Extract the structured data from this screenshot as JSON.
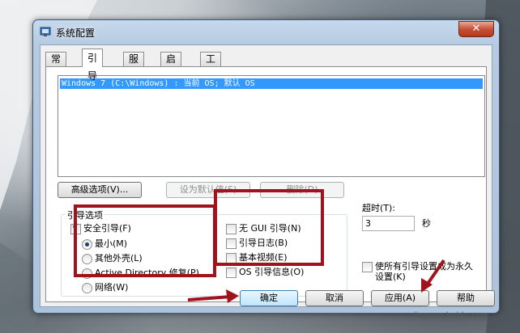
{
  "window": {
    "title": "系统配置",
    "close_label": "✕"
  },
  "tabs": [
    {
      "label": "常规"
    },
    {
      "label": "引导"
    },
    {
      "label": "服务"
    },
    {
      "label": "启动"
    },
    {
      "label": "工具"
    }
  ],
  "boot_list": {
    "items": [
      "Windows 7 (C:\\Windows) : 当前 OS; 默认 OS"
    ]
  },
  "entry_buttons": {
    "advanced": "高级选项(V)...",
    "set_default": "设为默认值(S)",
    "delete": "删除(D)"
  },
  "boot_options": {
    "group_title": "引导选项",
    "safe_boot": {
      "label": "安全引导(F)",
      "checked": true
    },
    "radios": [
      {
        "label": "最小(M)",
        "checked": true
      },
      {
        "label": "其他外壳(L)",
        "checked": false
      },
      {
        "label": "Active Directory 修复(P)",
        "checked": false
      },
      {
        "label": "网络(W)",
        "checked": false
      }
    ],
    "checkboxes": [
      {
        "label": "无 GUI 引导(N)",
        "checked": false
      },
      {
        "label": "引导日志(B)",
        "checked": false
      },
      {
        "label": "基本视频(E)",
        "checked": false
      },
      {
        "label": "OS 引导信息(O)",
        "checked": false
      }
    ]
  },
  "timeout": {
    "label": "超时(T):",
    "value": "3",
    "unit": "秒"
  },
  "permanent": {
    "label_line1": "使所有引导设置成为永久",
    "label_line2": "设置(K)",
    "checked": false
  },
  "dialog_buttons": {
    "ok": "确定",
    "cancel": "取消",
    "apply": "应用(A)",
    "help": "帮助"
  },
  "watermark": "jingyan.baidu.com",
  "colors": {
    "highlight_box": "#a1131c",
    "selection": "#3399ff"
  }
}
